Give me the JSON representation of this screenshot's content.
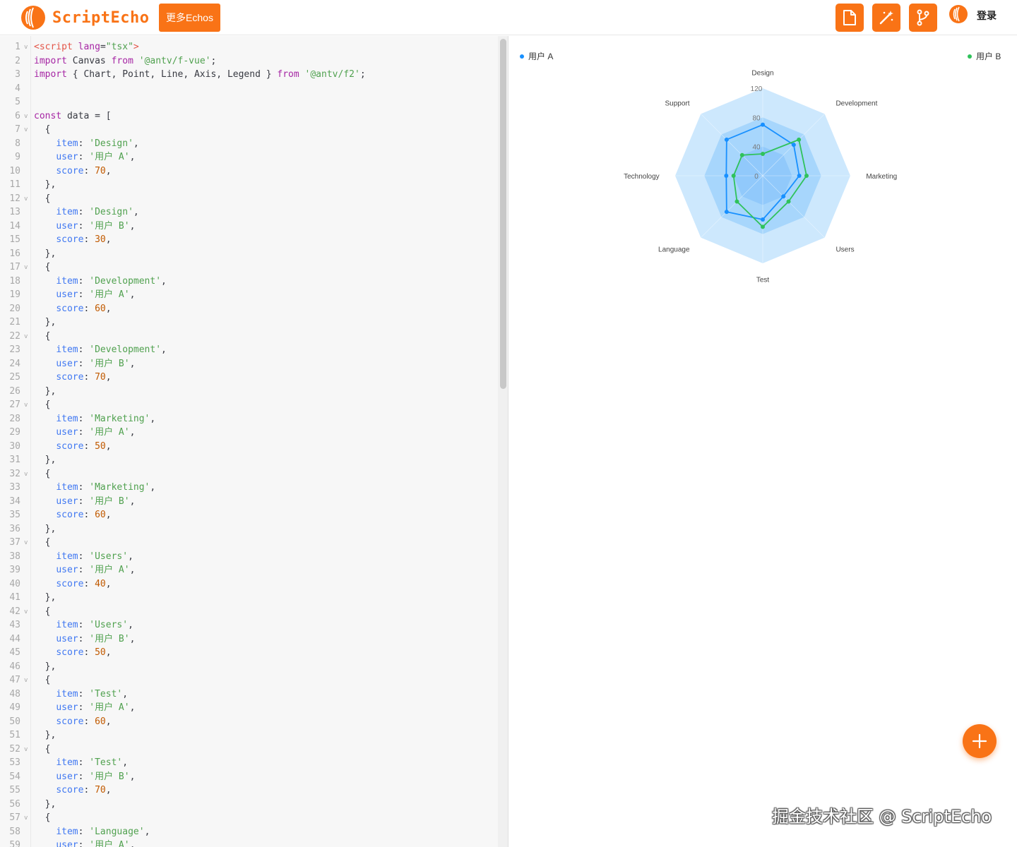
{
  "header": {
    "logo_text": "ScriptEcho",
    "more_button": "更多Echos",
    "login": "登录",
    "tools": [
      "file-icon",
      "magic-wand-icon",
      "branch-icon"
    ]
  },
  "editor": {
    "lines": [
      {
        "n": "1",
        "fold": true,
        "html": "<span class='t'>&lt;script</span> <span class='k'>lang</span>=<span class='s'>\"tsx\"</span><span class='t'>&gt;</span>"
      },
      {
        "n": "2",
        "html": "<span class='k'>import</span> Canvas <span class='k'>from</span> <span class='s'>'@antv/f-vue'</span>;"
      },
      {
        "n": "3",
        "html": "<span class='k'>import</span> { Chart, Point, Line, Axis, Legend } <span class='k'>from</span> <span class='s'>'@antv/f2'</span>;"
      },
      {
        "n": "4",
        "html": ""
      },
      {
        "n": "5",
        "html": ""
      },
      {
        "n": "6",
        "fold": true,
        "html": "<span class='k'>const</span> data = ["
      },
      {
        "n": "7",
        "fold": true,
        "html": "  {"
      },
      {
        "n": "8",
        "html": "    <span class='p'>item</span>: <span class='s'>'Design'</span>,"
      },
      {
        "n": "9",
        "html": "    <span class='p'>user</span>: <span class='s'>'用户 A'</span>,"
      },
      {
        "n": "10",
        "html": "    <span class='p'>score</span>: <span class='n'>70</span>,"
      },
      {
        "n": "11",
        "html": "  },"
      },
      {
        "n": "12",
        "fold": true,
        "html": "  {"
      },
      {
        "n": "13",
        "html": "    <span class='p'>item</span>: <span class='s'>'Design'</span>,"
      },
      {
        "n": "14",
        "html": "    <span class='p'>user</span>: <span class='s'>'用户 B'</span>,"
      },
      {
        "n": "15",
        "html": "    <span class='p'>score</span>: <span class='n'>30</span>,"
      },
      {
        "n": "16",
        "html": "  },"
      },
      {
        "n": "17",
        "fold": true,
        "html": "  {"
      },
      {
        "n": "18",
        "html": "    <span class='p'>item</span>: <span class='s'>'Development'</span>,"
      },
      {
        "n": "19",
        "html": "    <span class='p'>user</span>: <span class='s'>'用户 A'</span>,"
      },
      {
        "n": "20",
        "html": "    <span class='p'>score</span>: <span class='n'>60</span>,"
      },
      {
        "n": "21",
        "html": "  },"
      },
      {
        "n": "22",
        "fold": true,
        "html": "  {"
      },
      {
        "n": "23",
        "html": "    <span class='p'>item</span>: <span class='s'>'Development'</span>,"
      },
      {
        "n": "24",
        "html": "    <span class='p'>user</span>: <span class='s'>'用户 B'</span>,"
      },
      {
        "n": "25",
        "html": "    <span class='p'>score</span>: <span class='n'>70</span>,"
      },
      {
        "n": "26",
        "html": "  },"
      },
      {
        "n": "27",
        "fold": true,
        "html": "  {"
      },
      {
        "n": "28",
        "html": "    <span class='p'>item</span>: <span class='s'>'Marketing'</span>,"
      },
      {
        "n": "29",
        "html": "    <span class='p'>user</span>: <span class='s'>'用户 A'</span>,"
      },
      {
        "n": "30",
        "html": "    <span class='p'>score</span>: <span class='n'>50</span>,"
      },
      {
        "n": "31",
        "html": "  },"
      },
      {
        "n": "32",
        "fold": true,
        "html": "  {"
      },
      {
        "n": "33",
        "html": "    <span class='p'>item</span>: <span class='s'>'Marketing'</span>,"
      },
      {
        "n": "34",
        "html": "    <span class='p'>user</span>: <span class='s'>'用户 B'</span>,"
      },
      {
        "n": "35",
        "html": "    <span class='p'>score</span>: <span class='n'>60</span>,"
      },
      {
        "n": "36",
        "html": "  },"
      },
      {
        "n": "37",
        "fold": true,
        "html": "  {"
      },
      {
        "n": "38",
        "html": "    <span class='p'>item</span>: <span class='s'>'Users'</span>,"
      },
      {
        "n": "39",
        "html": "    <span class='p'>user</span>: <span class='s'>'用户 A'</span>,"
      },
      {
        "n": "40",
        "html": "    <span class='p'>score</span>: <span class='n'>40</span>,"
      },
      {
        "n": "41",
        "html": "  },"
      },
      {
        "n": "42",
        "fold": true,
        "html": "  {"
      },
      {
        "n": "43",
        "html": "    <span class='p'>item</span>: <span class='s'>'Users'</span>,"
      },
      {
        "n": "44",
        "html": "    <span class='p'>user</span>: <span class='s'>'用户 B'</span>,"
      },
      {
        "n": "45",
        "html": "    <span class='p'>score</span>: <span class='n'>50</span>,"
      },
      {
        "n": "46",
        "html": "  },"
      },
      {
        "n": "47",
        "fold": true,
        "html": "  {"
      },
      {
        "n": "48",
        "html": "    <span class='p'>item</span>: <span class='s'>'Test'</span>,"
      },
      {
        "n": "49",
        "html": "    <span class='p'>user</span>: <span class='s'>'用户 A'</span>,"
      },
      {
        "n": "50",
        "html": "    <span class='p'>score</span>: <span class='n'>60</span>,"
      },
      {
        "n": "51",
        "html": "  },"
      },
      {
        "n": "52",
        "fold": true,
        "html": "  {"
      },
      {
        "n": "53",
        "html": "    <span class='p'>item</span>: <span class='s'>'Test'</span>,"
      },
      {
        "n": "54",
        "html": "    <span class='p'>user</span>: <span class='s'>'用户 B'</span>,"
      },
      {
        "n": "55",
        "html": "    <span class='p'>score</span>: <span class='n'>70</span>,"
      },
      {
        "n": "56",
        "html": "  },"
      },
      {
        "n": "57",
        "fold": true,
        "html": "  {"
      },
      {
        "n": "58",
        "html": "    <span class='p'>item</span>: <span class='s'>'Language'</span>,"
      },
      {
        "n": "59",
        "html": "    <span class='p'>user</span>: <span class='s'>'用户 A'</span>,"
      }
    ]
  },
  "preview": {
    "watermark": "掘金技术社区 @ ScriptEcho",
    "fab": "add-icon"
  },
  "chart_data": {
    "type": "radar",
    "categories": [
      "Design",
      "Development",
      "Marketing",
      "Users",
      "Test",
      "Language",
      "Technology",
      "Support"
    ],
    "ticks": [
      "0",
      "40",
      "80",
      "120"
    ],
    "rlim": [
      0,
      120
    ],
    "legend": "top",
    "series": [
      {
        "name": "用户 A",
        "color": "#1890ff",
        "values": [
          70,
          60,
          50,
          40,
          60,
          70,
          50,
          70
        ]
      },
      {
        "name": "用户 B",
        "color": "#2fc25b",
        "values": [
          30,
          70,
          60,
          50,
          70,
          50,
          40,
          40
        ]
      }
    ]
  },
  "colors": {
    "accent": "#f97316",
    "band_outer": "#cde8fd",
    "band_mid": "#a7d6fc",
    "band_inner": "#91c9fb"
  }
}
